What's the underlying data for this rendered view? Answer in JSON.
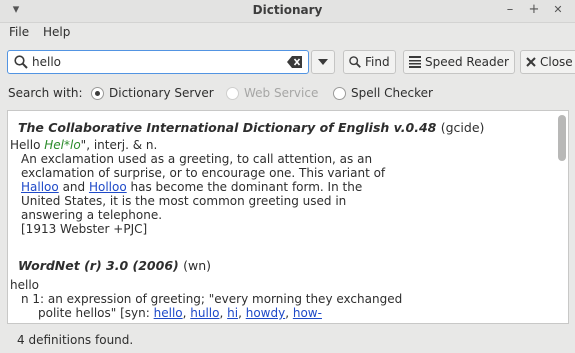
{
  "window": {
    "title": "Dictionary",
    "menu_glyph": "▾",
    "min_glyph": "–",
    "max_glyph": "+",
    "close_glyph": "✕"
  },
  "menu": {
    "file": "File",
    "help": "Help"
  },
  "search": {
    "value": "hello",
    "find_label": "Find",
    "speed_reader_label": "Speed Reader",
    "close_label": "Close"
  },
  "search_with": {
    "label": "Search with:",
    "options": [
      {
        "label": "Dictionary Server",
        "selected": true,
        "enabled": true
      },
      {
        "label": "Web Service",
        "selected": false,
        "enabled": false
      },
      {
        "label": "Spell Checker",
        "selected": false,
        "enabled": true
      }
    ]
  },
  "results": {
    "gcide": {
      "name": "The Collaborative International Dictionary of English v.0.48",
      "abbr": "(gcide)",
      "headword": "Hello",
      "pronunciation": "Hel*lo",
      "pos_suffix": "\", interj. & n.",
      "lines": [
        "An exclamation used as a greeting, to call attention, as an",
        "exclamation of surprise, or to encourage one. This variant of"
      ],
      "variant_link1": "Halloo",
      "variant_and": "and",
      "variant_link2": "Holloo",
      "variant_tail": "has become the dominant form. In the",
      "lines2": [
        "United States, it is the most common greeting used in",
        "answering a telephone.",
        "[1913 Webster +PJC]"
      ]
    },
    "wordnet": {
      "name": "WordNet (r) 3.0 (2006)",
      "abbr": "(wn)",
      "headword": "hello",
      "sense": "n 1: an expression of greeting; \"every morning they exchanged",
      "sense_cont": "polite hellos\" [syn:",
      "syn_links": [
        "hello",
        "hullo",
        "hi",
        "howdy",
        "how-"
      ]
    }
  },
  "status": {
    "text": "4 definitions found."
  },
  "colors": {
    "accent": "#5294e2",
    "link": "#1e49c8",
    "pronunciation": "#2a8b2a"
  }
}
